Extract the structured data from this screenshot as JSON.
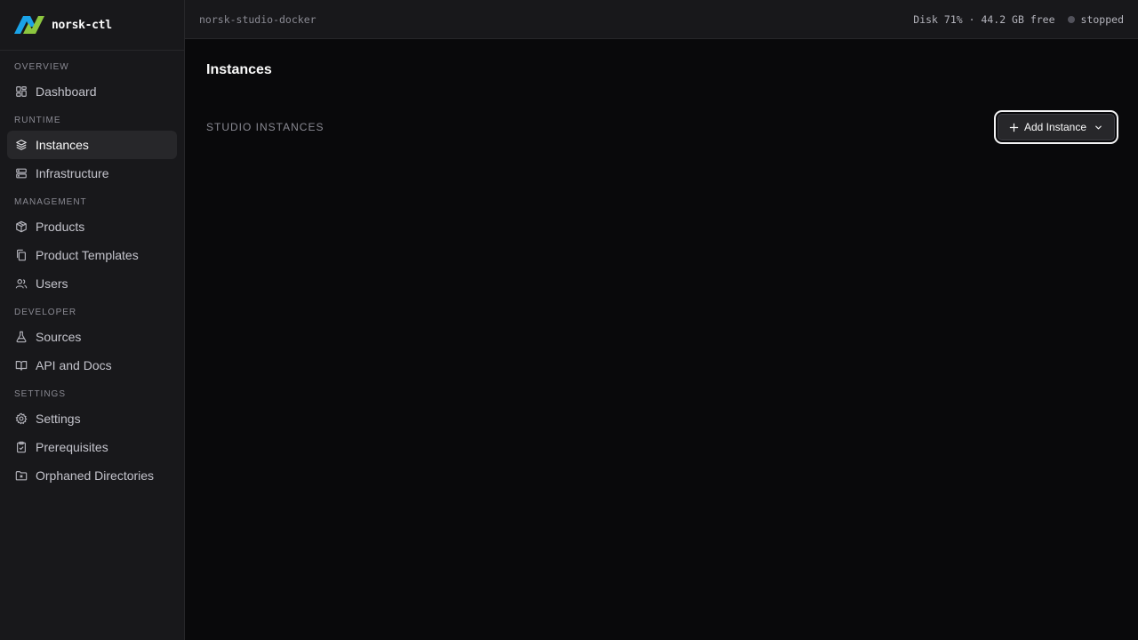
{
  "brand": {
    "name": "norsk-ctl",
    "colors": {
      "blue": "#1aa3e8",
      "green": "#8cc63f"
    }
  },
  "sidebar": {
    "sections": [
      {
        "heading": "OVERVIEW",
        "items": [
          {
            "label": "Dashboard",
            "icon": "dashboard-icon"
          }
        ]
      },
      {
        "heading": "RUNTIME",
        "items": [
          {
            "label": "Instances",
            "icon": "layers-icon",
            "active": true
          },
          {
            "label": "Infrastructure",
            "icon": "server-icon"
          }
        ]
      },
      {
        "heading": "MANAGEMENT",
        "items": [
          {
            "label": "Products",
            "icon": "package-icon"
          },
          {
            "label": "Product Templates",
            "icon": "copy-icon"
          },
          {
            "label": "Users",
            "icon": "users-icon"
          }
        ]
      },
      {
        "heading": "DEVELOPER",
        "items": [
          {
            "label": "Sources",
            "icon": "flask-icon"
          },
          {
            "label": "API and Docs",
            "icon": "book-icon"
          }
        ]
      },
      {
        "heading": "SETTINGS",
        "items": [
          {
            "label": "Settings",
            "icon": "gear-icon"
          },
          {
            "label": "Prerequisites",
            "icon": "clipboard-check-icon"
          },
          {
            "label": "Orphaned Directories",
            "icon": "folder-x-icon"
          }
        ]
      }
    ]
  },
  "topbar": {
    "project": "norsk-studio-docker",
    "disk": "Disk 71% · 44.2 GB free",
    "status": "stopped",
    "status_color": "#52525b"
  },
  "main": {
    "title": "Instances",
    "section_title": "STUDIO INSTANCES",
    "add_button": {
      "label": "Add Instance",
      "icon": "plus-icon",
      "dropdown_icon": "chevron-down-icon"
    }
  }
}
